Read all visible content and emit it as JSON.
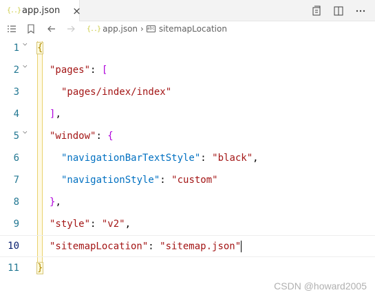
{
  "tab": {
    "icon": "json-braces-icon",
    "label": "app.json",
    "close": "×"
  },
  "editor_actions": [
    "open-preview-icon",
    "split-editor-icon",
    "more-actions-icon"
  ],
  "breadcrumb": {
    "file": "app.json",
    "symbol": "sitemapLocation"
  },
  "gutter": [
    "1",
    "2",
    "3",
    "4",
    "5",
    "6",
    "7",
    "8",
    "9",
    "10",
    "11"
  ],
  "code": {
    "l1_open": "{",
    "l2_key": "\"pages\"",
    "l2_colon": ": ",
    "l2_open": "[",
    "l3_val": "\"pages/index/index\"",
    "l4_close": "]",
    "l4_comma": ",",
    "l5_key": "\"window\"",
    "l5_colon": ": ",
    "l5_open": "{",
    "l6_key": "\"navigationBarTextStyle\"",
    "l6_colon": ": ",
    "l6_val": "\"black\"",
    "l6_comma": ",",
    "l7_key": "\"navigationStyle\"",
    "l7_colon": ": ",
    "l7_val": "\"custom\"",
    "l8_close": "}",
    "l8_comma": ",",
    "l9_key": "\"style\"",
    "l9_colon": ": ",
    "l9_val": "\"v2\"",
    "l9_comma": ",",
    "l10_key": "\"sitemapLocation\"",
    "l10_colon": ": ",
    "l10_val": "\"sitemap.json\"",
    "l11_close": "}"
  },
  "watermark": "CSDN @howard2005"
}
